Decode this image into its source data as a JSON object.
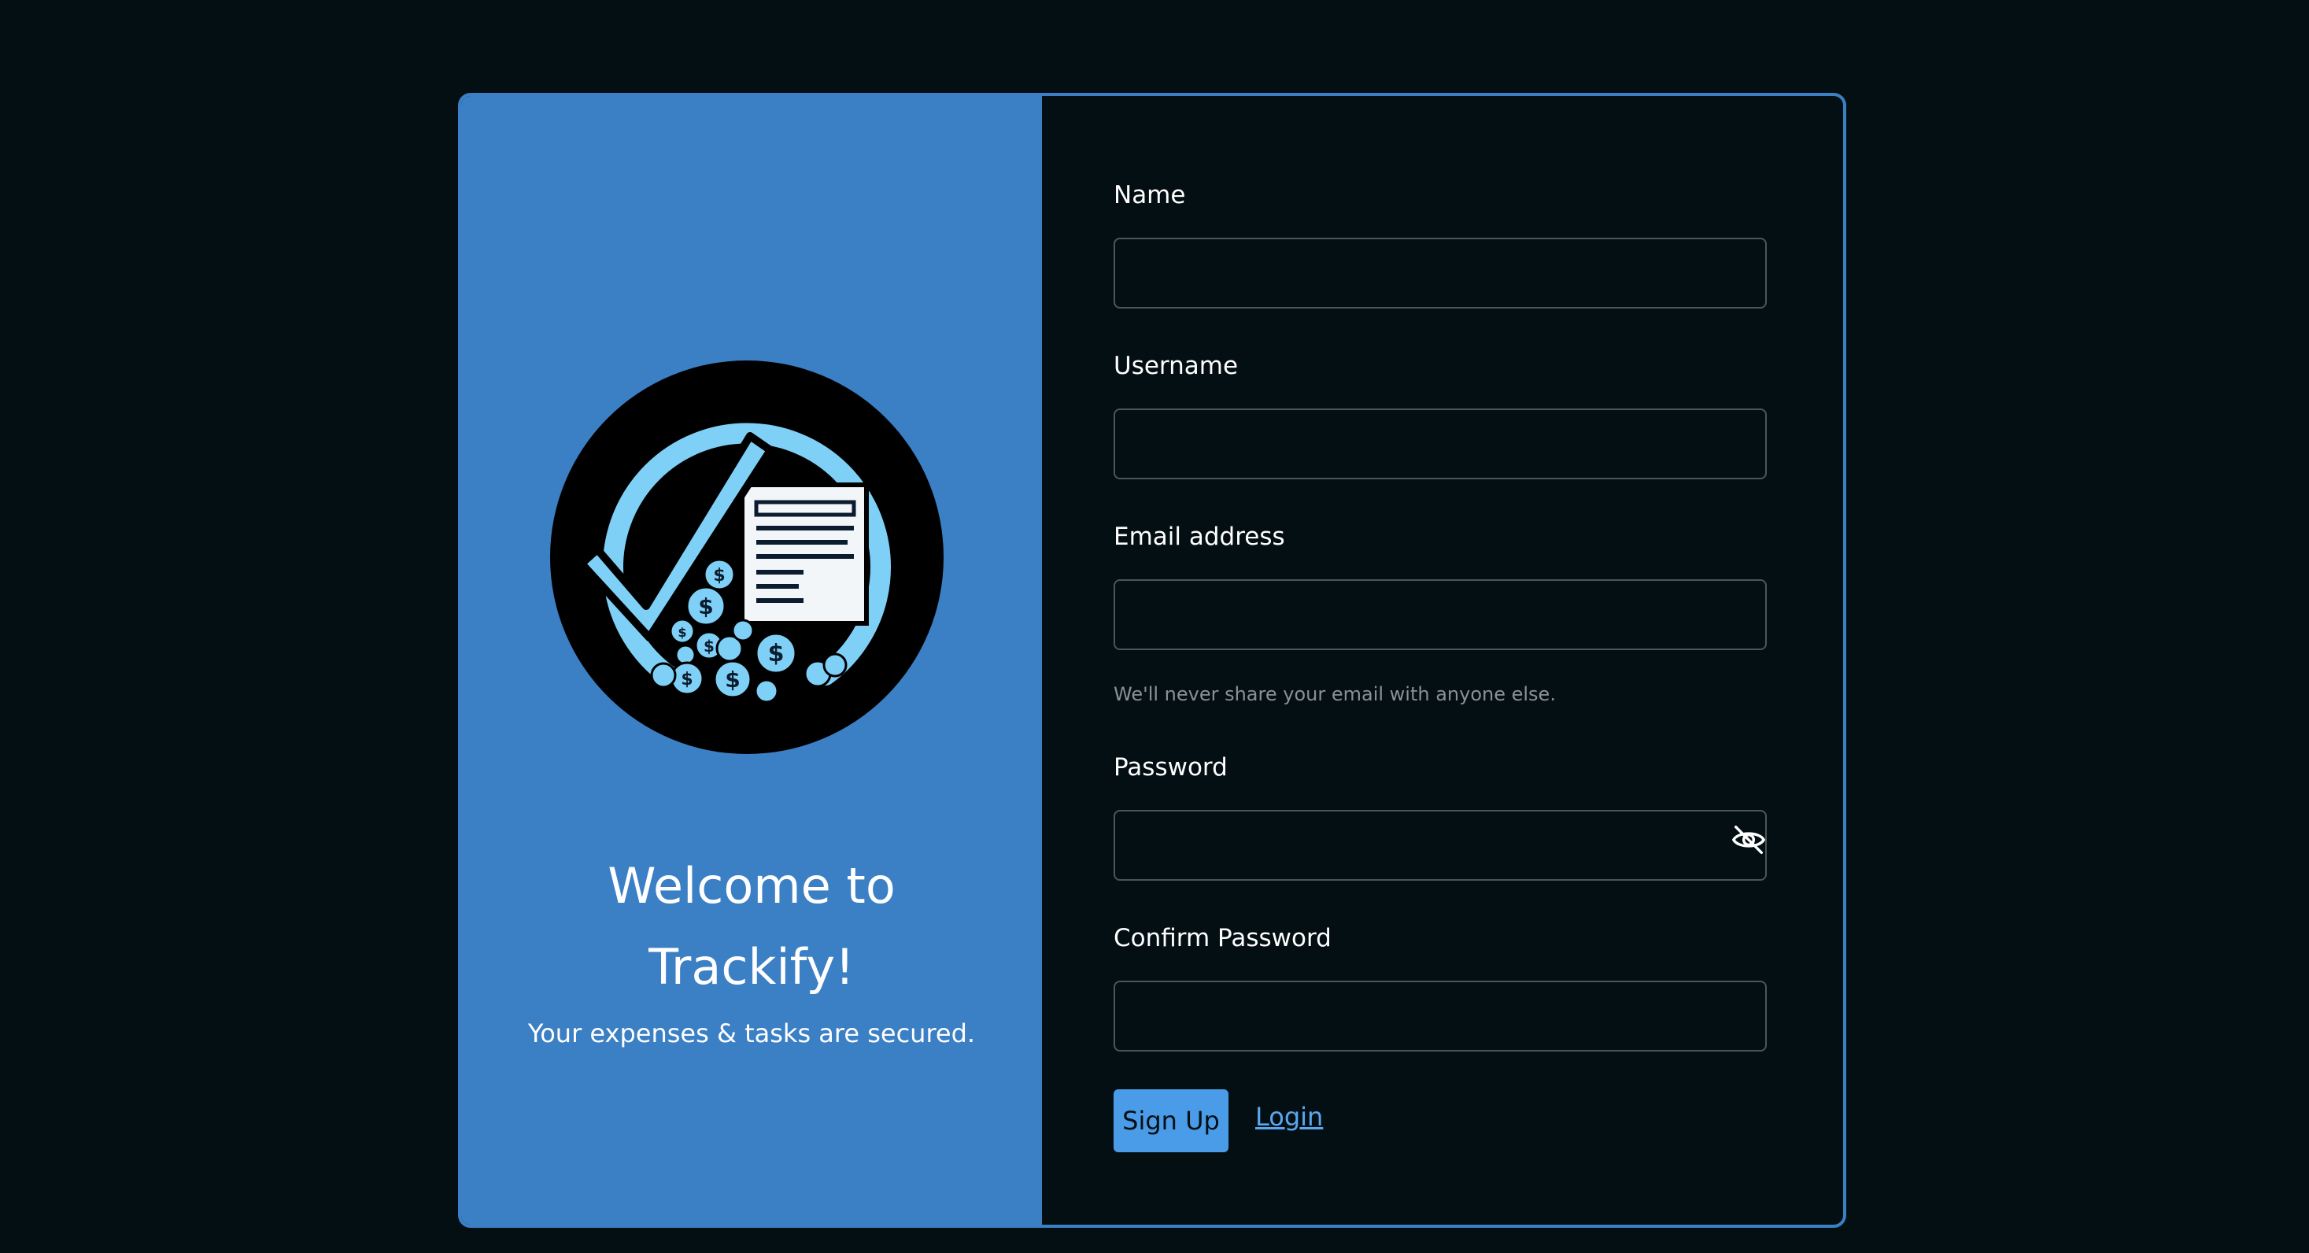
{
  "brand": {
    "welcome_line1": "Welcome to",
    "welcome_line2": "Trackify!",
    "tagline": "Your expenses & tasks are secured.",
    "logo_icon": "trackify-logo-icon",
    "accent_color": "#3b7fc4"
  },
  "form": {
    "name_label": "Name",
    "name_value": "",
    "username_label": "Username",
    "username_value": "",
    "email_label": "Email address",
    "email_value": "",
    "email_help": "We'll never share your email with anyone else.",
    "password_label": "Password",
    "password_value": "",
    "password_toggle_icon": "eye-slash-icon",
    "confirm_label": "Confirm Password",
    "confirm_value": "",
    "signup_label": "Sign Up",
    "login_label": "Login"
  }
}
